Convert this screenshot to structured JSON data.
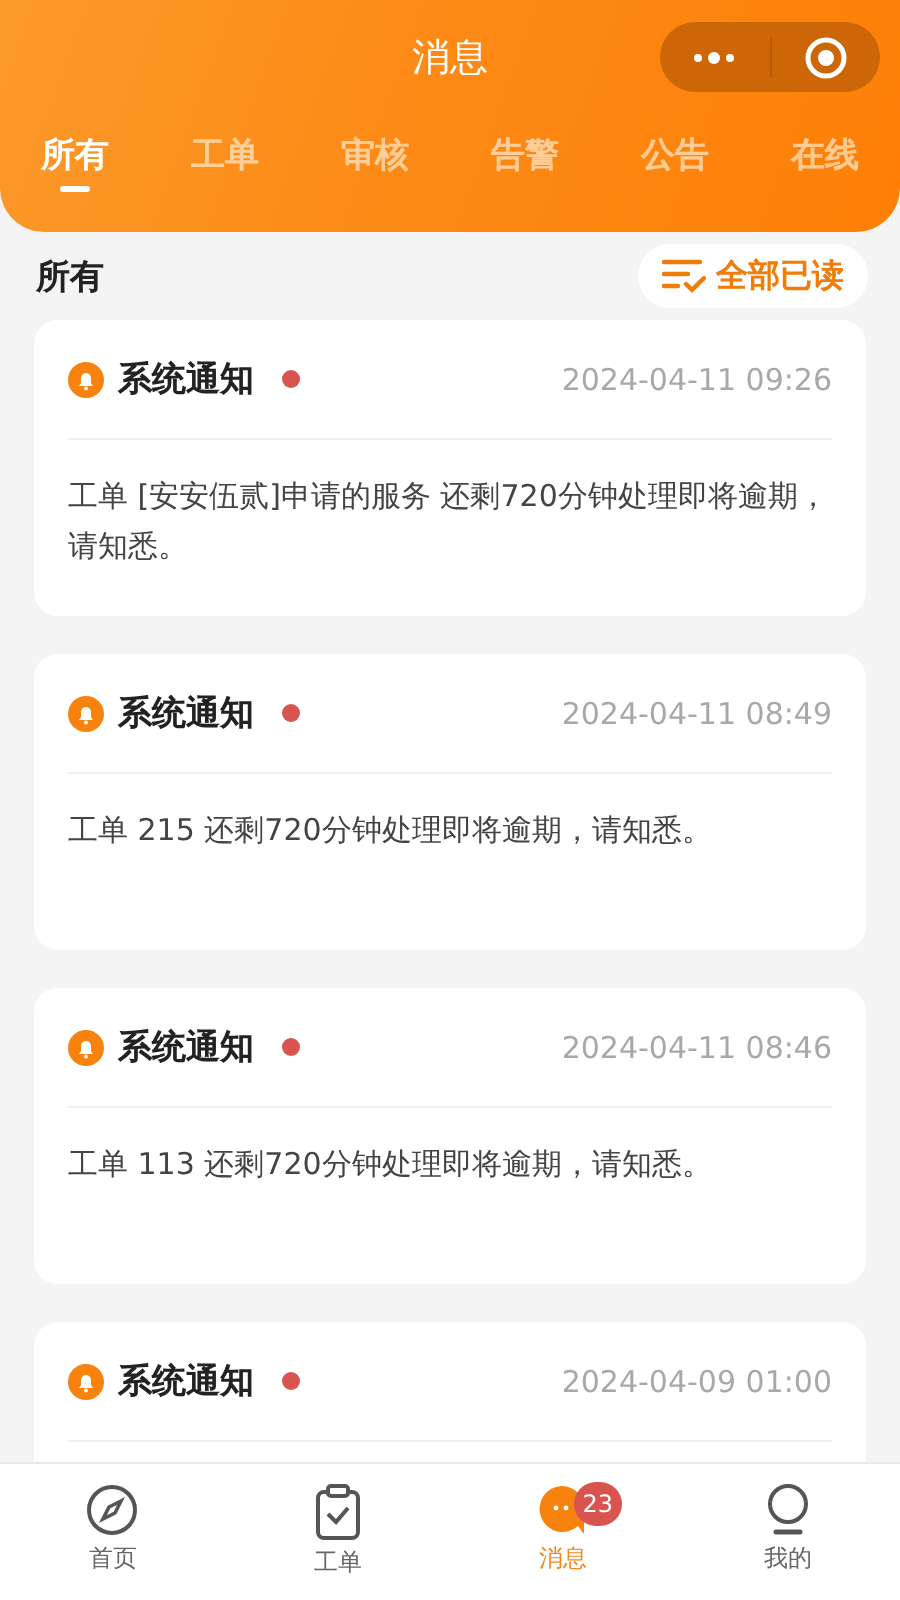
{
  "header": {
    "title": "消息"
  },
  "tabs": [
    {
      "label": "所有",
      "selected": true
    },
    {
      "label": "工单",
      "selected": false
    },
    {
      "label": "审核",
      "selected": false
    },
    {
      "label": "告警",
      "selected": false
    },
    {
      "label": "公告",
      "selected": false
    },
    {
      "label": "在线",
      "selected": false
    }
  ],
  "section": {
    "title": "所有",
    "mark_all_read": "全部已读"
  },
  "messages": [
    {
      "title": "系统通知",
      "unread": true,
      "time": "2024-04-11 09:26",
      "body": "工单 [安安伍贰]申请的服务 还剩720分钟处理即将逾期，请知悉。"
    },
    {
      "title": "系统通知",
      "unread": true,
      "time": "2024-04-11 08:49",
      "body": "工单 215 还剩720分钟处理即将逾期，请知悉。"
    },
    {
      "title": "系统通知",
      "unread": true,
      "time": "2024-04-11 08:46",
      "body": "工单 113 还剩720分钟处理即将逾期，请知悉。"
    },
    {
      "title": "系统通知",
      "unread": true,
      "time": "2024-04-09 01:00"
    }
  ],
  "nav": [
    {
      "kind": "home",
      "label": "首页",
      "selected": false
    },
    {
      "kind": "orders",
      "label": "工单",
      "selected": false
    },
    {
      "kind": "messages",
      "label": "消息",
      "selected": true,
      "badge": "23"
    },
    {
      "kind": "me",
      "label": "我的",
      "selected": false
    }
  ]
}
